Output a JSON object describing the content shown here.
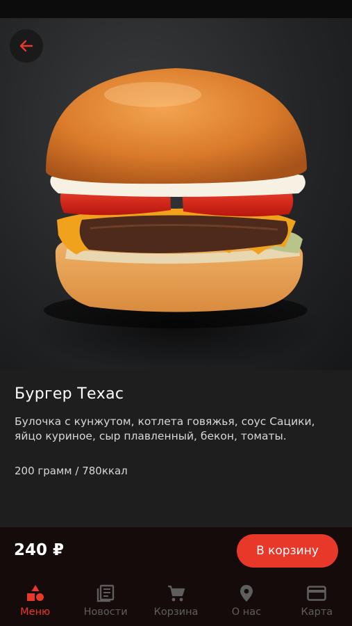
{
  "product": {
    "name": "Бургер Техас",
    "description": "Булочка с кунжутом, котлета говяжья, соус Сацики, яйцо куриное, сыр плавленный, бекон, томаты.",
    "weight_energy": "200 грамм / 780ккал",
    "price": "240 ₽",
    "add_to_cart_label": "В корзину"
  },
  "header": {
    "back_icon": "arrow-left-icon"
  },
  "tabbar": {
    "tabs": [
      {
        "label": "Меню",
        "icon": "menu-shapes-icon",
        "active": true
      },
      {
        "label": "Новости",
        "icon": "news-icon",
        "active": false
      },
      {
        "label": "Корзина",
        "icon": "cart-icon",
        "active": false
      },
      {
        "label": "О нас",
        "icon": "location-pin-icon",
        "active": false
      },
      {
        "label": "Карта",
        "icon": "card-icon",
        "active": false
      }
    ]
  },
  "colors": {
    "accent": "#e8382a",
    "background": "#1e1e1e",
    "bar_background": "#160b0b",
    "inactive": "#5e5e5e"
  }
}
